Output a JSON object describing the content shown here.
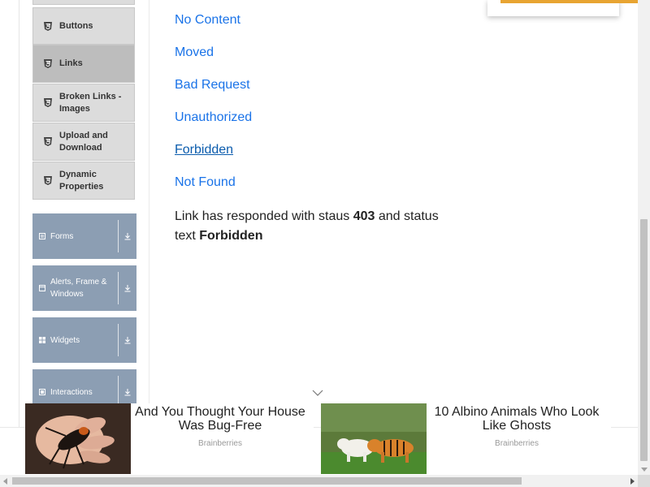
{
  "sidebar": {
    "sub_items": [
      {
        "label": "Buttons"
      },
      {
        "label": "Links"
      },
      {
        "label": "Broken Links - Images"
      },
      {
        "label": "Upload and Download"
      },
      {
        "label": "Dynamic Properties"
      }
    ],
    "groups": [
      {
        "label": "Forms"
      },
      {
        "label": "Alerts, Frame & Windows"
      },
      {
        "label": "Widgets"
      },
      {
        "label": "Interactions"
      }
    ]
  },
  "main": {
    "links": [
      {
        "label": "No Content"
      },
      {
        "label": "Moved"
      },
      {
        "label": "Bad Request"
      },
      {
        "label": "Unauthorized"
      },
      {
        "label": "Forbidden"
      },
      {
        "label": "Not Found"
      }
    ],
    "response": {
      "prefix": "Link has responded with staus",
      "code": "403",
      "middle": "and status text",
      "status_text": "Forbidden"
    }
  },
  "ads": [
    {
      "title": "And You Thought Your House Was Bug-Free",
      "source": "Brainberries"
    },
    {
      "title": "10 Albino Animals Who Look Like Ghosts",
      "source": "Brainberries"
    }
  ],
  "colors": {
    "link": "#1a73e8",
    "sidebar_group": "#8c9eb3",
    "accent": "#e8a432"
  }
}
